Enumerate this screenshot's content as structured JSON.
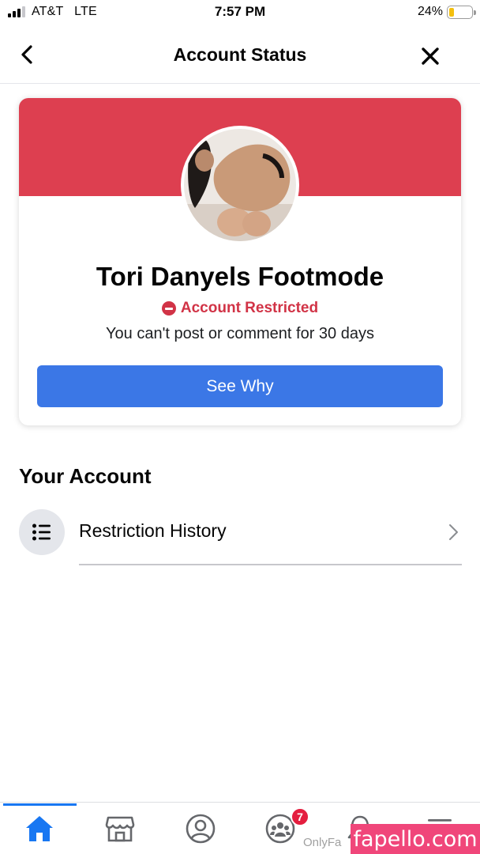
{
  "status_bar": {
    "carrier": "AT&T   LTE",
    "time": "7:57 PM",
    "battery_percent": "24%",
    "battery_level": 0.24,
    "signal_bars_on": 3
  },
  "nav": {
    "title": "Account Status",
    "back_icon": "chevron-left-icon",
    "close_icon": "close-icon"
  },
  "status_card": {
    "banner_color": "#dd3f50",
    "profile_name": "Tori Danyels Footmode",
    "status_label": "Account Restricted",
    "status_color": "#d13346",
    "restriction_detail": "You can't post or comment for 30 days",
    "button_label": "See Why",
    "button_color": "#3b77e6"
  },
  "your_account": {
    "title": "Your Account",
    "items": [
      {
        "label": "Restriction History",
        "icon": "list-icon"
      }
    ]
  },
  "tab_bar": {
    "active_color": "#1877f2",
    "tabs": [
      {
        "name": "home",
        "icon": "home-icon"
      },
      {
        "name": "marketplace",
        "icon": "store-icon"
      },
      {
        "name": "profile",
        "icon": "profile-icon"
      },
      {
        "name": "groups",
        "icon": "groups-icon",
        "badge": "7"
      },
      {
        "name": "notifications",
        "icon": "bell-icon"
      },
      {
        "name": "menu",
        "icon": "menu-icon"
      }
    ],
    "badge_color": "#e41e3f"
  },
  "watermark": {
    "small_text": "OnlyFa",
    "box_text": "fapello.com",
    "box_color": "#f0467a"
  }
}
